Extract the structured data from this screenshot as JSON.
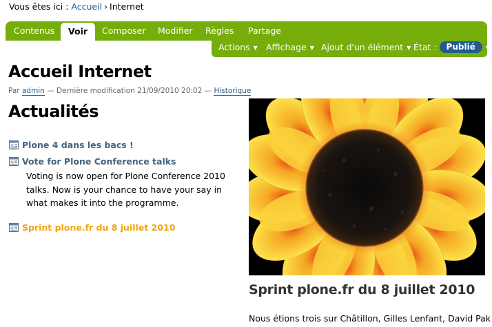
{
  "breadcrumb": {
    "prefix": "Vous êtes ici :",
    "items": [
      "Accueil",
      "Internet"
    ],
    "separator": "›"
  },
  "tabs": [
    {
      "label": "Contenus",
      "active": false
    },
    {
      "label": "Voir",
      "active": true
    },
    {
      "label": "Composer",
      "active": false
    },
    {
      "label": "Modifier",
      "active": false
    },
    {
      "label": "Règles",
      "active": false
    },
    {
      "label": "Partage",
      "active": false
    }
  ],
  "actions": {
    "actions_label": "Actions",
    "display_label": "Affichage",
    "add_label": "Ajout d'un élément",
    "state_label": "État :",
    "state_value": "Publié",
    "caret": "▼"
  },
  "page": {
    "title": "Accueil Internet",
    "byline_by": "Par",
    "author": "admin",
    "byline_modified": "— Dernière modification 21/09/2010 20:02 —",
    "history_link": "Historique"
  },
  "news": {
    "title": "Actualités",
    "items": [
      {
        "title": "Plone 4 dans les bacs !"
      },
      {
        "title": "Vote for Plone Conference talks",
        "description": "Voting is now open for Plone Conference 2010 talks. Now is your chance to have your say in what makes it into the programme."
      },
      {
        "title": "Sprint plone.fr du 8 juillet 2010"
      }
    ]
  },
  "feature": {
    "image_name": "sunflower-image",
    "title": "Sprint plone.fr du 8 juillet 2010",
    "text": "Nous étions trois sur Châtillon, Gilles Lenfant, David Pak et"
  },
  "colors": {
    "nav_green": "#75ad0a",
    "link_blue": "#205c90",
    "news_title": "#44627e",
    "highlight_orange": "#f0a40e"
  }
}
